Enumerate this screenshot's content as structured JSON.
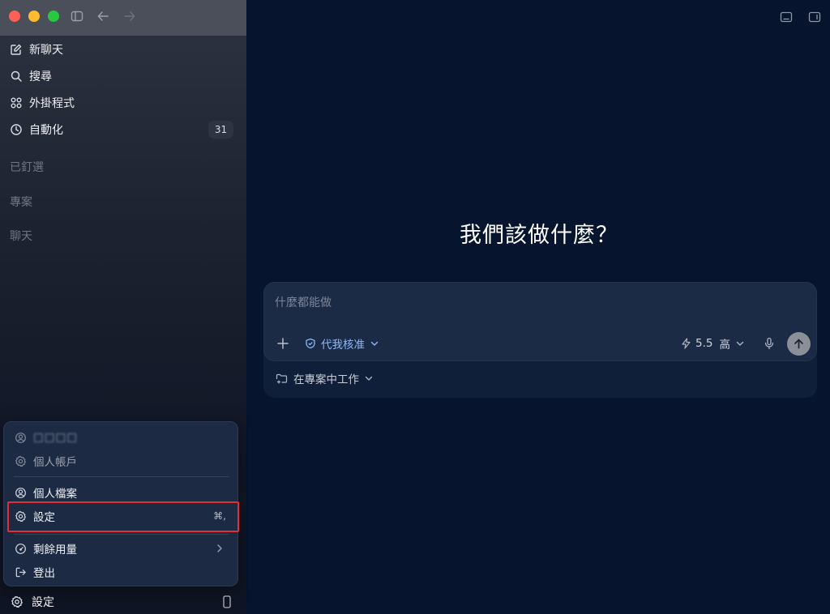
{
  "sidebar": {
    "nav": [
      {
        "label": "新聊天",
        "icon": "edit-icon"
      },
      {
        "label": "搜尋",
        "icon": "search-icon"
      },
      {
        "label": "外掛程式",
        "icon": "plugins-icon"
      },
      {
        "label": "自動化",
        "icon": "clock-icon",
        "badge": "31"
      }
    ],
    "sections": {
      "pinned": "已釘選",
      "projects": "專案",
      "chats": "聊天"
    },
    "bottom": {
      "label": "設定",
      "icon": "gear-icon"
    }
  },
  "account_menu": {
    "email_blurred": "□□□□",
    "personal_account": "個人帳戶",
    "profile": "個人檔案",
    "settings": "設定",
    "settings_shortcut": "⌘,",
    "usage": "剩餘用量",
    "logout": "登出"
  },
  "main": {
    "headline": "我們該做什麼？",
    "composer": {
      "placeholder": "什麼都能做",
      "approval_label": "代我核准",
      "model_version": "5.5",
      "reasoning_level": "高"
    },
    "project_label": "在專案中工作"
  },
  "colors": {
    "main_bg": "#06142e",
    "accent_blue": "#8fb8ff",
    "highlight_red": "#e0302f"
  }
}
